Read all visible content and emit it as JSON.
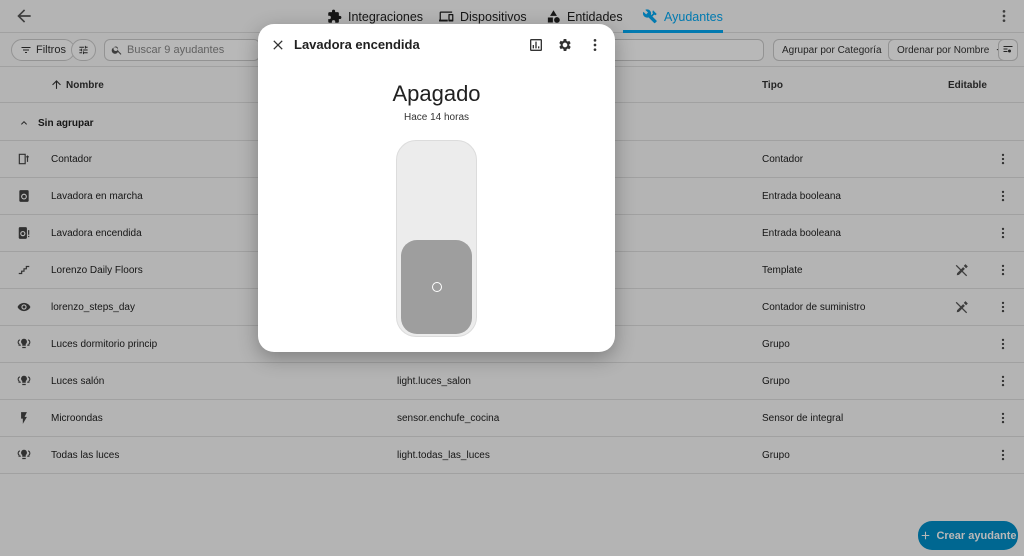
{
  "tabs": [
    {
      "label": "Integraciones",
      "icon": "puzzle-icon"
    },
    {
      "label": "Dispositivos",
      "icon": "devices-icon"
    },
    {
      "label": "Entidades",
      "icon": "shapes-icon"
    },
    {
      "label": "Ayudantes",
      "icon": "tools-icon",
      "active": true
    }
  ],
  "toolbar": {
    "filters_label": "Filtros",
    "search_placeholder": "Buscar 9 ayudantes",
    "group_by_label": "Agrupar por Categoría",
    "sort_by_label": "Ordenar por Nombre"
  },
  "table": {
    "headers": {
      "name": "Nombre",
      "type": "Tipo",
      "editable": "Editable"
    },
    "group_label": "Sin agrupar",
    "rows": [
      {
        "name": "Contador",
        "entity": "",
        "type": "Contador",
        "icon": "counter-icon",
        "not_editable": false
      },
      {
        "name": "Lavadora en marcha",
        "entity": "",
        "type": "Entrada booleana",
        "icon": "washing-machine-icon",
        "not_editable": false
      },
      {
        "name": "Lavadora encendida",
        "entity": "",
        "type": "Entrada booleana",
        "icon": "washing-machine-alert-icon",
        "not_editable": false
      },
      {
        "name": "Lorenzo Daily Floors",
        "entity": "",
        "type": "Template",
        "icon": "stairs-icon",
        "not_editable": true
      },
      {
        "name": "lorenzo_steps_day",
        "entity": "",
        "type": "Contador de suministro",
        "icon": "eye-icon",
        "not_editable": true
      },
      {
        "name": "Luces dormitorio princip",
        "entity": "",
        "type": "Grupo",
        "icon": "lightbulb-group-icon",
        "not_editable": false
      },
      {
        "name": "Luces salón",
        "entity": "light.luces_salon",
        "type": "Grupo",
        "icon": "lightbulb-group-icon",
        "not_editable": false
      },
      {
        "name": "Microondas",
        "entity": "sensor.enchufe_cocina",
        "type": "Sensor de integral",
        "icon": "flash-icon",
        "not_editable": false
      },
      {
        "name": "Todas las luces",
        "entity": "light.todas_las_luces",
        "type": "Grupo",
        "icon": "lightbulb-group-icon",
        "not_editable": false
      }
    ]
  },
  "fab_label": "Crear ayudante",
  "dialog": {
    "title": "Lavadora encendida",
    "state": "Apagado",
    "last_changed": "Hace 14 horas",
    "toggle_on": false
  },
  "colors": {
    "accent": "#03a9f4",
    "fab": "#018fc9",
    "knob": "#9e9e9e"
  }
}
